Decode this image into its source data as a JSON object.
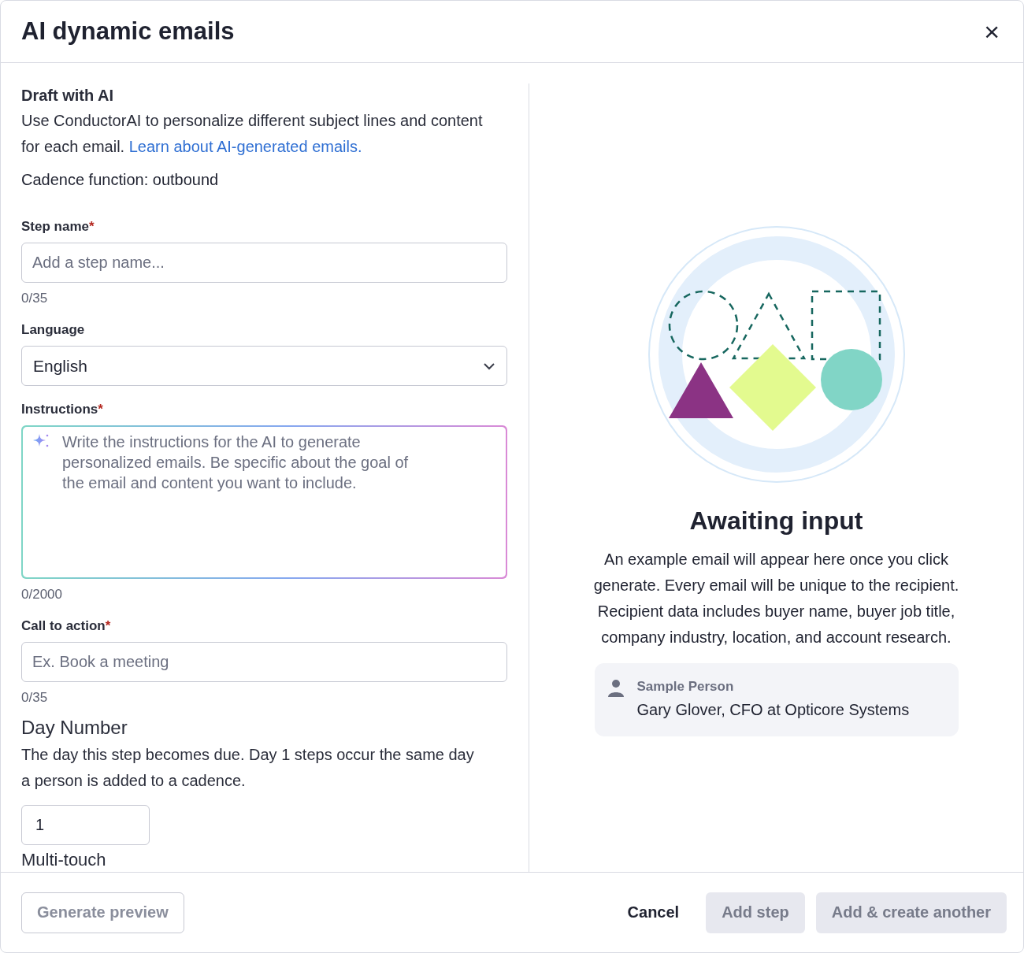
{
  "dialog": {
    "title": "AI dynamic emails",
    "close": "×"
  },
  "form": {
    "heading": "Draft with AI",
    "description": "Use ConductorAI to personalize different subject lines and content for each email.",
    "link": "Learn about AI-generated emails.",
    "cadence": "Cadence function: outbound",
    "required_marker": "*",
    "fields": [
      {
        "kind": "text",
        "label": "Step name",
        "required": true,
        "placeholder": "Add a step name...",
        "count": "0/35"
      },
      {
        "kind": "select",
        "label": "Language",
        "required": false,
        "value": "English"
      },
      {
        "kind": "textarea",
        "label": "Instructions",
        "required": true,
        "placeholder": "Write the instructions for the AI to generate personalized emails. Be specific about the goal of the email and content you want to include.",
        "count": "0/2000"
      },
      {
        "kind": "text",
        "label": "Call to action",
        "required": true,
        "placeholder": "Ex. Book a meeting",
        "count": "0/35"
      }
    ],
    "day_number": {
      "heading": "Day Number",
      "description": "The day this step becomes due. Day 1 steps occur the same day a person is added to a cadence.",
      "value": "1"
    },
    "next_section": "Multi-touch"
  },
  "preview": {
    "title": "Awaiting input",
    "description": "An example email will appear here once you click generate. Every email will be unique to the recipient. Recipient data includes buyer name, buyer job title, company industry, location, and account research.",
    "sample": {
      "label": "Sample Person",
      "value": "Gary Glover, CFO at Opticore Systems"
    }
  },
  "footer": {
    "preview_button": {
      "label": "Generate preview",
      "disabled": true
    },
    "actions": [
      {
        "kind": "plain",
        "label": "Cancel",
        "disabled": false
      },
      {
        "kind": "filled",
        "label": "Add step",
        "disabled": true
      },
      {
        "kind": "filled",
        "label": "Add & create another",
        "disabled": true
      }
    ]
  }
}
